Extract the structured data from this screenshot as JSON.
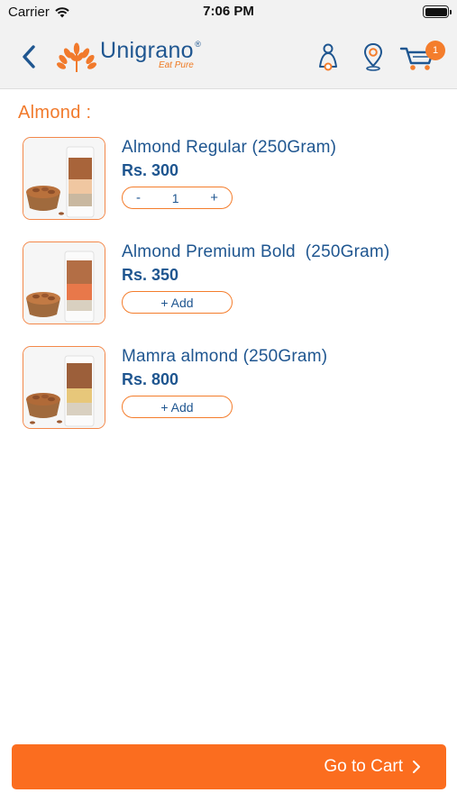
{
  "status_bar": {
    "carrier": "Carrier",
    "time": "7:06 PM"
  },
  "header": {
    "logo_name": "Unigrano",
    "logo_reg": "®",
    "logo_tagline": "Eat Pure",
    "cart_count": "1",
    "icons": [
      "back-chevron-icon",
      "profile-icon",
      "location-pin-icon",
      "cart-icon"
    ]
  },
  "category": {
    "title": "Almond :"
  },
  "products": [
    {
      "name": "Almond Regular (250Gram)",
      "price": "Rs. 300",
      "in_cart": true,
      "quantity": "1",
      "minus": "-",
      "plus": "+"
    },
    {
      "name": "Almond Premium Bold  (250Gram)",
      "price": "Rs. 350",
      "in_cart": false,
      "add_label": "+ Add"
    },
    {
      "name": "Mamra almond (250Gram)",
      "price": "Rs. 800",
      "in_cart": false,
      "add_label": "+ Add"
    }
  ],
  "footer": {
    "go_to_cart_label": "Go to Cart"
  },
  "colors": {
    "brand_blue": "#1f5690",
    "brand_orange": "#f47d2c",
    "button_orange": "#fb6d1f"
  }
}
